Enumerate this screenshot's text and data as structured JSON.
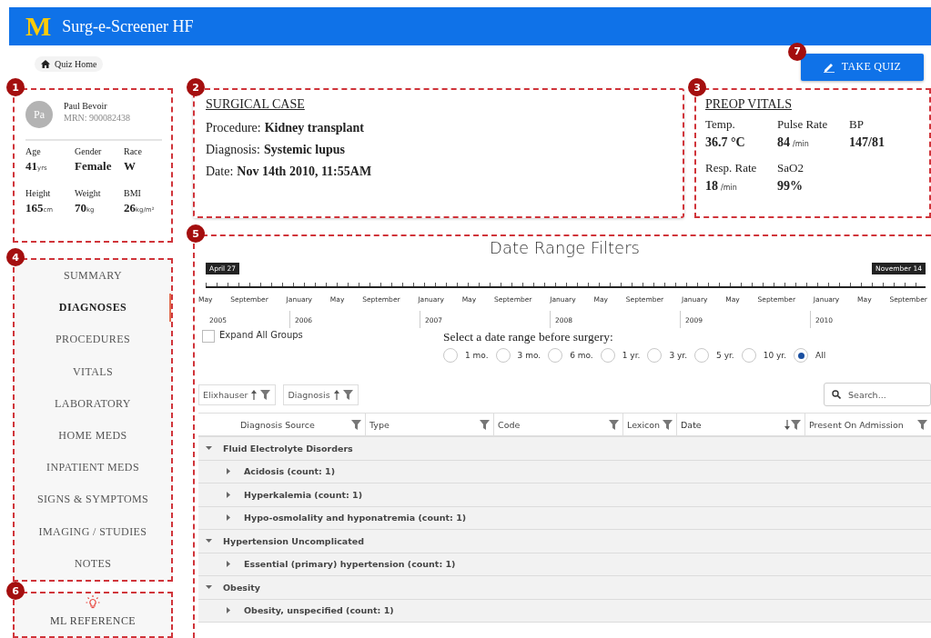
{
  "header": {
    "logo": "M",
    "title": "Surg-e-Screener HF"
  },
  "breadcrumb": {
    "label": "Quiz Home"
  },
  "take_quiz": {
    "label": "TAKE QUIZ",
    "badge": "7"
  },
  "patient": {
    "badge": "1",
    "initials": "Pa",
    "name": "Paul Bevoir",
    "mrn": "MRN: 900082438",
    "stats": [
      {
        "label": "Age",
        "value": "41",
        "unit": "yrs"
      },
      {
        "label": "Gender",
        "value": "Female"
      },
      {
        "label": "Race",
        "value": "W"
      },
      {
        "label": "Height",
        "value": "165",
        "unit": "cm"
      },
      {
        "label": "Weight",
        "value": "70",
        "unit": "kg"
      },
      {
        "label": "BMI",
        "value": "26",
        "unit": "kg/m²"
      }
    ]
  },
  "nav": {
    "badge": "4",
    "items": [
      {
        "label": "SUMMARY",
        "selected": false
      },
      {
        "label": "DIAGNOSES",
        "selected": true
      },
      {
        "label": "PROCEDURES",
        "selected": false
      },
      {
        "label": "VITALS",
        "selected": false
      },
      {
        "label": "LABORATORY",
        "selected": false
      },
      {
        "label": "HOME MEDS",
        "selected": false
      },
      {
        "label": "INPATIENT MEDS",
        "selected": false
      },
      {
        "label": "SIGNS & SYMPTOMS",
        "selected": false
      },
      {
        "label": "IMAGING / STUDIES",
        "selected": false
      },
      {
        "label": "NOTES",
        "selected": false
      }
    ]
  },
  "ml_reference": {
    "badge": "6",
    "label": "ML REFERENCE"
  },
  "surgical_case": {
    "badge": "2",
    "title": "SURGICAL CASE",
    "fields": [
      {
        "label": "Procedure:",
        "value": "Kidney transplant"
      },
      {
        "label": "Diagnosis:",
        "value": "Systemic lupus"
      },
      {
        "label": "Date:",
        "value": "Nov 14th 2010, 11:55AM"
      }
    ]
  },
  "preop_vitals": {
    "badge": "3",
    "title": "PREOP VITALS",
    "items": [
      {
        "label": "Temp.",
        "value": "36.7 °C"
      },
      {
        "label": "Pulse Rate",
        "value": "84",
        "unit": "/min"
      },
      {
        "label": "BP",
        "value": "147/81"
      },
      {
        "label": "Resp. Rate",
        "value": "18",
        "unit": "/min"
      },
      {
        "label": "SaO2",
        "value": "99%"
      }
    ]
  },
  "date_filters": {
    "badge": "5",
    "title": "Date Range Filters",
    "range_start": "April 27",
    "range_end": "November 14",
    "months": [
      "May",
      "September",
      "January",
      "May",
      "September",
      "January",
      "May",
      "September",
      "January",
      "May",
      "September",
      "January",
      "May",
      "September",
      "January",
      "May",
      "September"
    ],
    "years": [
      "2005",
      "2006",
      "2007",
      "2008",
      "2009",
      "2010"
    ],
    "expand_all": {
      "label": "Expand All Groups",
      "checked": false
    },
    "range_prompt": "Select a date range before surgery:",
    "ranges": [
      {
        "label": "1 mo.",
        "selected": false
      },
      {
        "label": "3 mo.",
        "selected": false
      },
      {
        "label": "6 mo.",
        "selected": false
      },
      {
        "label": "1 yr.",
        "selected": false
      },
      {
        "label": "3 yr.",
        "selected": false
      },
      {
        "label": "5 yr.",
        "selected": false
      },
      {
        "label": "10 yr.",
        "selected": false
      },
      {
        "label": "All",
        "selected": true
      }
    ]
  },
  "grid": {
    "group_chips": [
      {
        "label": "Elixhauser",
        "ascending": true
      },
      {
        "label": "Diagnosis",
        "ascending": true
      }
    ],
    "search": {
      "placeholder": "Search..."
    },
    "columns": [
      {
        "label": "Diagnosis Source",
        "sorted_descending": false
      },
      {
        "label": "Type",
        "sorted_descending": false
      },
      {
        "label": "Code",
        "sorted_descending": false
      },
      {
        "label": "Lexicon",
        "sorted_descending": false
      },
      {
        "label": "Date",
        "sorted_descending": true
      },
      {
        "label": "Present On Admission",
        "sorted_descending": false
      }
    ],
    "groups": [
      {
        "label": "Fluid Electrolyte Disorders",
        "expanded": true,
        "children": [
          {
            "label": "Acidosis (count: 1)",
            "expanded": false
          },
          {
            "label": "Hyperkalemia (count: 1)",
            "expanded": false
          },
          {
            "label": "Hypo-osmolality and hyponatremia (count: 1)",
            "expanded": false
          }
        ]
      },
      {
        "label": "Hypertension Uncomplicated",
        "expanded": true,
        "children": [
          {
            "label": "Essential (primary) hypertension (count: 1)",
            "expanded": false
          }
        ]
      },
      {
        "label": "Obesity",
        "expanded": true,
        "children": [
          {
            "label": "Obesity, unspecified (count: 1)",
            "expanded": false
          }
        ]
      }
    ]
  }
}
